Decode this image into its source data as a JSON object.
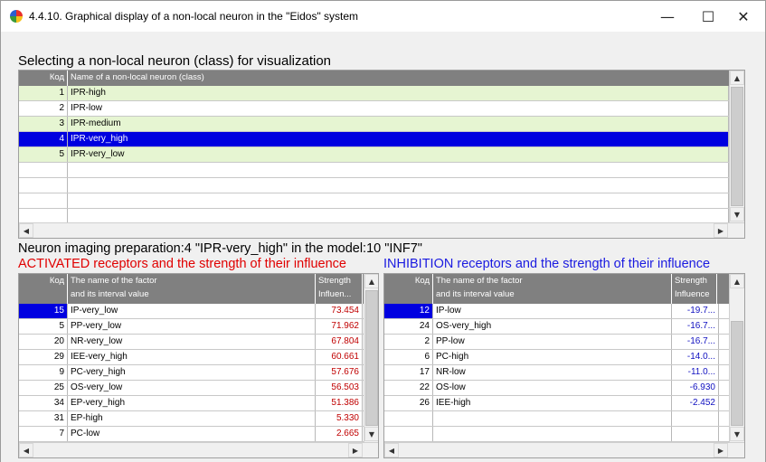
{
  "window": {
    "title": "4.4.10. Graphical display of a non-local neuron in the \"Eidos\" system",
    "minimize": "—",
    "maximize": "☐",
    "close": "✕"
  },
  "top_section": {
    "heading": "Selecting a non-local neuron (class) for visualization",
    "columns": [
      "Код",
      "Name of a non-local neuron (class)"
    ],
    "rows": [
      {
        "code": "1",
        "name": "IPR-high"
      },
      {
        "code": "2",
        "name": "IPR-low"
      },
      {
        "code": "3",
        "name": "IPR-medium"
      },
      {
        "code": "4",
        "name": "IPR-very_high"
      },
      {
        "code": "5",
        "name": "IPR-very_low"
      }
    ],
    "selected_code": "4"
  },
  "status": {
    "line": "Neuron imaging preparation:4 \"IPR-very_high\" in the model:10 \"INF7\""
  },
  "activated": {
    "heading": "ACTIVATED receptors and the strength of their influence",
    "columns": [
      "Код",
      "The name of the factor",
      "and its interval value",
      "Strength",
      "Influen..."
    ],
    "rows": [
      {
        "code": "15",
        "name": "IP-very_low",
        "strength": "73.454"
      },
      {
        "code": "5",
        "name": "PP-very_low",
        "strength": "71.962"
      },
      {
        "code": "20",
        "name": "NR-very_low",
        "strength": "67.804"
      },
      {
        "code": "29",
        "name": "IEE-very_high",
        "strength": "60.661"
      },
      {
        "code": "9",
        "name": "PC-very_high",
        "strength": "57.676"
      },
      {
        "code": "25",
        "name": "OS-very_low",
        "strength": "56.503"
      },
      {
        "code": "34",
        "name": "EP-very_high",
        "strength": "51.386"
      },
      {
        "code": "31",
        "name": "EP-high",
        "strength": "5.330"
      },
      {
        "code": "7",
        "name": "PC-low",
        "strength": "2.665"
      }
    ]
  },
  "inhibition": {
    "heading": "INHIBITION receptors and the strength of their influence",
    "columns": [
      "Код",
      "The name of the factor",
      "and its interval value",
      "Strength",
      "Influence"
    ],
    "rows": [
      {
        "code": "12",
        "name": "IP-low",
        "strength": "-19.7..."
      },
      {
        "code": "24",
        "name": "OS-very_high",
        "strength": "-16.7..."
      },
      {
        "code": "2",
        "name": "PP-low",
        "strength": "-16.7..."
      },
      {
        "code": "6",
        "name": "PC-high",
        "strength": "-14.0..."
      },
      {
        "code": "17",
        "name": "NR-low",
        "strength": "-11.0..."
      },
      {
        "code": "22",
        "name": "OS-low",
        "strength": "-6.930"
      },
      {
        "code": "26",
        "name": "IEE-high",
        "strength": "-2.452"
      }
    ]
  },
  "colors": {
    "activated": "#e00000",
    "inhibition": "#1a1ae0",
    "selection": "#0000e0",
    "row_highlight": "#e6f5d2"
  }
}
